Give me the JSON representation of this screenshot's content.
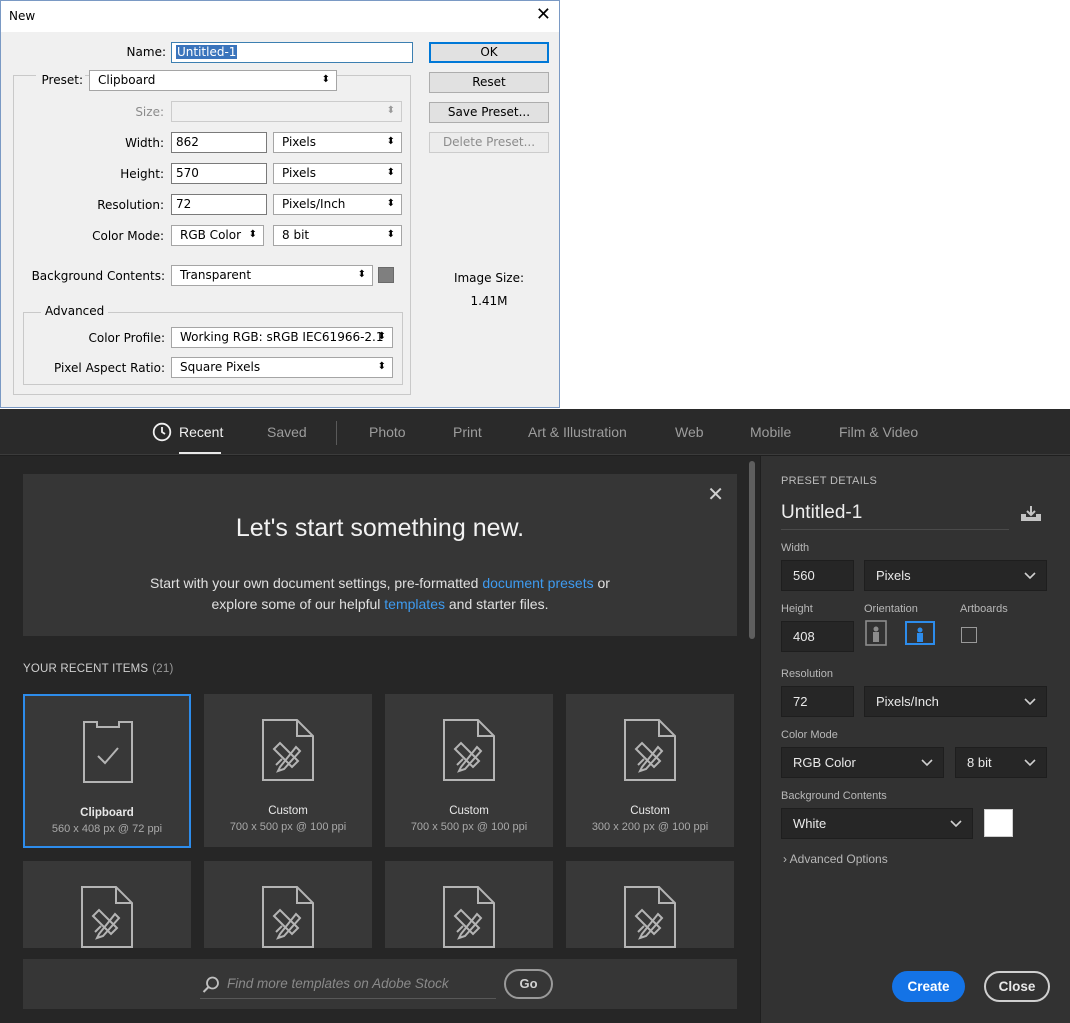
{
  "old_dialog": {
    "title": "New",
    "name_label": "Name:",
    "name_value": "Untitled-1",
    "preset_label": "Preset:",
    "preset_value": "Clipboard",
    "size_label": "Size:",
    "size_value": "",
    "width_label": "Width:",
    "width_value": "862",
    "width_unit": "Pixels",
    "height_label": "Height:",
    "height_value": "570",
    "height_unit": "Pixels",
    "resolution_label": "Resolution:",
    "resolution_value": "72",
    "resolution_unit": "Pixels/Inch",
    "color_mode_label": "Color Mode:",
    "color_mode_value": "RGB Color",
    "bit_depth_value": "8 bit",
    "bg_label": "Background Contents:",
    "bg_value": "Transparent",
    "advanced_label": "Advanced",
    "color_profile_label": "Color Profile:",
    "color_profile_value": "Working RGB:  sRGB IEC61966-2.1",
    "pixel_aspect_label": "Pixel Aspect Ratio:",
    "pixel_aspect_value": "Square Pixels",
    "buttons": {
      "ok": "OK",
      "reset": "Reset",
      "save_preset": "Save Preset...",
      "delete_preset": "Delete Preset..."
    },
    "image_size_label": "Image Size:",
    "image_size_value": "1.41M",
    "bg_swatch_color": "#7f7f7f"
  },
  "new_dialog": {
    "tabs": {
      "recent": "Recent",
      "saved": "Saved",
      "photo": "Photo",
      "print": "Print",
      "art": "Art & Illustration",
      "web": "Web",
      "mobile": "Mobile",
      "film": "Film & Video"
    },
    "hero": {
      "title": "Let's start something new.",
      "line1_a": "Start with your own document settings, pre-formatted ",
      "line1_link": "document presets",
      "line1_b": " or",
      "line2_a": "explore some of our helpful ",
      "line2_link": "templates",
      "line2_b": " and starter files."
    },
    "recent_heading": "YOUR RECENT ITEMS",
    "recent_count": "(21)",
    "recent_items": [
      {
        "name": "Clipboard",
        "dims": "560 x 408 px @ 72 ppi"
      },
      {
        "name": "Custom",
        "dims": "700 x 500 px @ 100 ppi"
      },
      {
        "name": "Custom",
        "dims": "700 x 500 px @ 100 ppi"
      },
      {
        "name": "Custom",
        "dims": "300 x 200 px @ 100 ppi"
      }
    ],
    "stock_placeholder": "Find more templates on Adobe Stock",
    "go_label": "Go",
    "panel": {
      "title": "PRESET DETAILS",
      "name": "Untitled-1",
      "width_label": "Width",
      "width_value": "560",
      "width_unit": "Pixels",
      "height_label": "Height",
      "height_value": "408",
      "orientation_label": "Orientation",
      "artboards_label": "Artboards",
      "resolution_label": "Resolution",
      "resolution_value": "72",
      "resolution_unit": "Pixels/Inch",
      "color_mode_label": "Color Mode",
      "color_mode_value": "RGB Color",
      "bit_depth_value": "8 bit",
      "bg_label": "Background Contents",
      "bg_value": "White",
      "advanced_options": "Advanced Options",
      "create": "Create",
      "close": "Close"
    },
    "accent_color": "#1473e6",
    "link_color": "#3e9bf0"
  }
}
